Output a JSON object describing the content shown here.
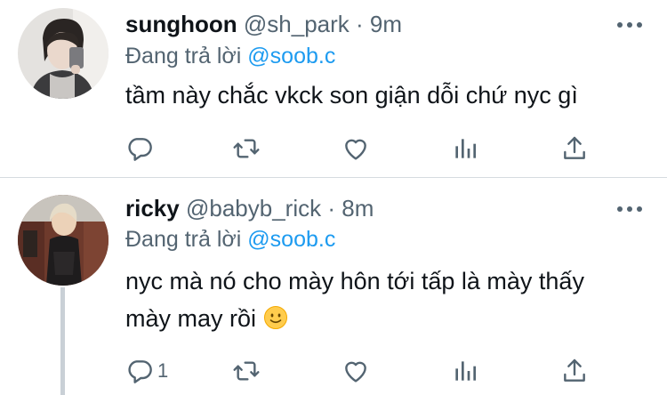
{
  "tweets": [
    {
      "name": "sunghoon",
      "handle": "@sh_park",
      "separator": "·",
      "time": "9m",
      "reply_prefix": "Đang trả lời",
      "reply_handle": "@soob.c",
      "text": "tầm này chắc vkck son giận dỗi chứ nyc gì",
      "reply_count": "",
      "icons": [
        "reply-icon",
        "retweet-icon",
        "like-icon",
        "stats-icon",
        "share-icon",
        "more-icon"
      ]
    },
    {
      "name": "ricky",
      "handle": "@babyb_rick",
      "separator": "·",
      "time": "8m",
      "reply_prefix": "Đang trả lời",
      "reply_handle": "@soob.c",
      "text_line1": "nyc mà nó cho mày hôn tới tấp là mày thấy",
      "text_line2": "mày may rồi",
      "reply_count": "1",
      "icons": [
        "reply-icon",
        "retweet-icon",
        "like-icon",
        "stats-icon",
        "share-icon",
        "more-icon",
        "slightly-smiling-face-emoji"
      ]
    }
  ],
  "colors": {
    "text": "#0f1419",
    "secondary": "#536471",
    "link": "#1d9bf0",
    "divider": "#d6dbe0",
    "thread_line": "#c9d0d6"
  }
}
